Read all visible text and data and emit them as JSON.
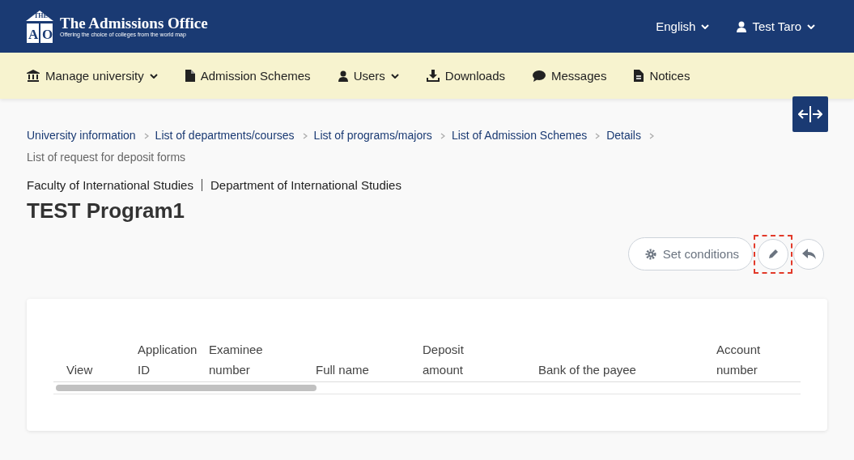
{
  "header": {
    "logo_letters": [
      "THE",
      "A",
      "O"
    ],
    "title": "The Admissions Office",
    "tagline": "Offering the choice of colleges from the world map",
    "language": "English",
    "user": "Test Taro"
  },
  "nav": [
    {
      "label": "Manage university",
      "dropdown": true
    },
    {
      "label": "Admission Schemes",
      "dropdown": false
    },
    {
      "label": "Users",
      "dropdown": true
    },
    {
      "label": "Downloads",
      "dropdown": false
    },
    {
      "label": "Messages",
      "dropdown": false
    },
    {
      "label": "Notices",
      "dropdown": false
    }
  ],
  "breadcrumb": [
    {
      "label": "University information",
      "current": false
    },
    {
      "label": "List of departments/courses",
      "current": false
    },
    {
      "label": "List of programs/majors",
      "current": false
    },
    {
      "label": "List of Admission Schemes",
      "current": false
    },
    {
      "label": "Details",
      "current": false
    },
    {
      "label": "List of request for deposit forms",
      "current": true
    }
  ],
  "faculty": "Faculty of International Studies",
  "department": "Department of International Studies",
  "title": "TEST Program1",
  "actions": [
    {
      "kind": "text",
      "label": "Set conditions",
      "highlighted": false
    },
    {
      "kind": "edit",
      "highlighted": true
    },
    {
      "kind": "back",
      "highlighted": false
    }
  ],
  "table": {
    "columns": [
      [
        "View"
      ],
      [
        "Application",
        "ID"
      ],
      [
        "Examinee",
        "number"
      ],
      [
        "Full name"
      ],
      [
        "Deposit",
        "amount"
      ],
      [
        "Bank of the payee"
      ],
      [
        "Account",
        "number"
      ]
    ]
  }
}
